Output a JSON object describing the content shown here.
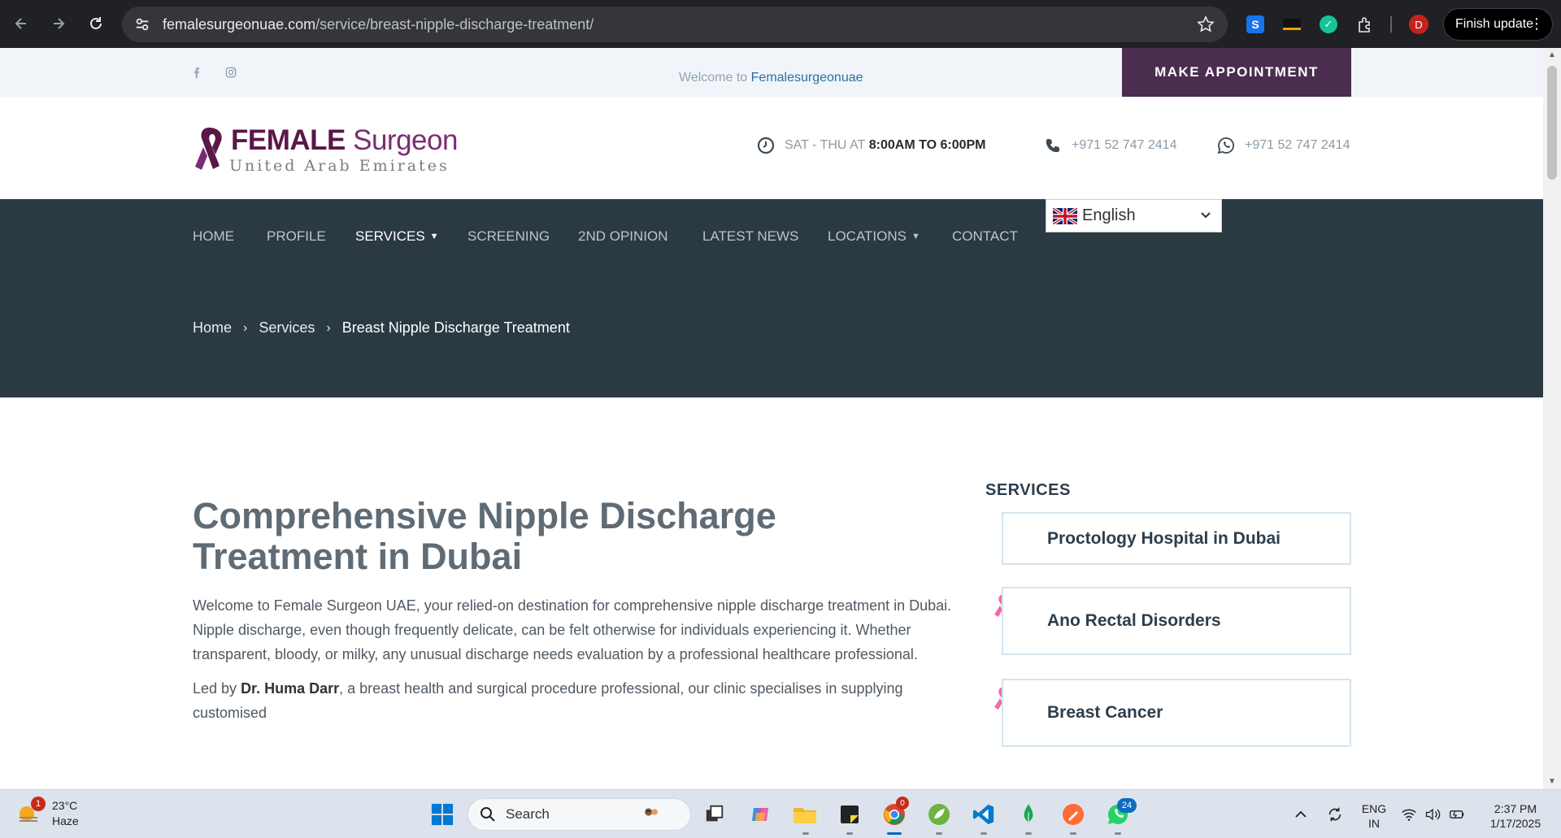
{
  "browser": {
    "url_host": "femalesurgeonuae.com",
    "url_path": "/service/breast-nipple-discharge-treatment/",
    "profile_initial": "D",
    "finish_update_label": "Finish update"
  },
  "topbar": {
    "welcome_prefix": "Welcome to",
    "welcome_link": "Femalesurgeonuae",
    "appointment_button": "MAKE APPOINTMENT"
  },
  "header": {
    "logo_bold": "FEMALE",
    "logo_light": "Surgeon",
    "logo_sub": "United Arab Emirates",
    "hours_prefix": "SAT - THU AT",
    "hours_value": "8:00AM TO 6:00PM",
    "phone": "+971 52 747 2414",
    "whatsapp": "+971 52 747 2414"
  },
  "nav": {
    "items": [
      "HOME",
      "PROFILE",
      "SERVICES",
      "SCREENING",
      "2ND OPINION",
      "LATEST NEWS",
      "LOCATIONS",
      "CONTACT"
    ],
    "active": "SERVICES",
    "language": "English"
  },
  "breadcrumb": {
    "home": "Home",
    "services": "Services",
    "current": "Breast Nipple Discharge Treatment"
  },
  "main": {
    "title": "Comprehensive Nipple Discharge Treatment in Dubai",
    "para1": "Welcome to Female Surgeon UAE, your relied-on destination for comprehensive nipple discharge treatment in Dubai. Nipple discharge, even though frequently delicate, can be felt otherwise for individuals experiencing it. Whether transparent, bloody, or milky, any unusual discharge needs evaluation by a professional healthcare professional.",
    "para2_prefix": "Led by",
    "para2_name": "Dr. Huma Darr",
    "para2_rest": ", a breast health and surgical procedure professional, our clinic specialises in supplying customised"
  },
  "sidebar": {
    "title": "SERVICES",
    "items": [
      "Proctology Hospital in Dubai",
      "Ano Rectal Disorders",
      "Breast Cancer"
    ]
  },
  "taskbar": {
    "weather_badge": "1",
    "temperature": "23°C",
    "condition": "Haze",
    "search_label": "Search",
    "whatsapp_badge": "24",
    "chrome_badge": "0",
    "lang_line1": "ENG",
    "lang_line2": "IN",
    "time": "2:37 PM",
    "date": "1/17/2025"
  },
  "colors": {
    "nav_band": "#2b3942",
    "appointment_bg": "#4a2d4f",
    "logo_purple": "#5a1748",
    "ribbon_pink": "#f06aa5",
    "topbar_bg": "#f1f5f9"
  }
}
